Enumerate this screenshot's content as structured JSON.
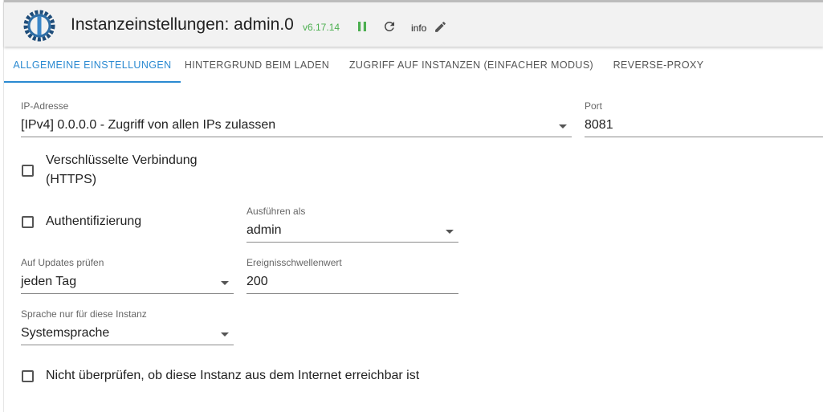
{
  "header": {
    "title": "Instanzeinstellungen: admin.0",
    "version": "v6.17.14",
    "info_label": "info",
    "colors": {
      "version": "#4caf50",
      "pause": "#4caf50",
      "accent": "#2b8ad1"
    },
    "icons": [
      "iobroker-logo-icon",
      "pause-icon",
      "refresh-icon",
      "edit-pencil-icon"
    ]
  },
  "tabs": [
    {
      "label": "ALLGEMEINE EINSTELLUNGEN",
      "active": true
    },
    {
      "label": "HINTERGRUND BEIM LADEN",
      "active": false
    },
    {
      "label": "ZUGRIFF AUF INSTANZEN (EINFACHER MODUS)",
      "active": false
    },
    {
      "label": "REVERSE-PROXY",
      "active": false
    }
  ],
  "form": {
    "ip": {
      "label": "IP-Adresse",
      "value": "[IPv4] 0.0.0.0 - Zugriff von allen IPs zulassen"
    },
    "port": {
      "label": "Port",
      "value": "8081"
    },
    "https": {
      "label_line1": "Verschlüsselte Verbindung",
      "label_line2": "(HTTPS)",
      "checked": false
    },
    "auth": {
      "label": "Authentifizierung",
      "checked": false
    },
    "run_as": {
      "label": "Ausführen als",
      "value": "admin"
    },
    "updates": {
      "label": "Auf Updates prüfen",
      "value": "jeden Tag"
    },
    "threshold": {
      "label": "Ereignisschwellenwert",
      "value": "200"
    },
    "language": {
      "label": "Sprache nur für diese Instanz",
      "value": "Systemsprache"
    },
    "no_check": {
      "label": "Nicht überprüfen, ob diese Instanz aus dem Internet erreichbar ist",
      "checked": false
    }
  }
}
